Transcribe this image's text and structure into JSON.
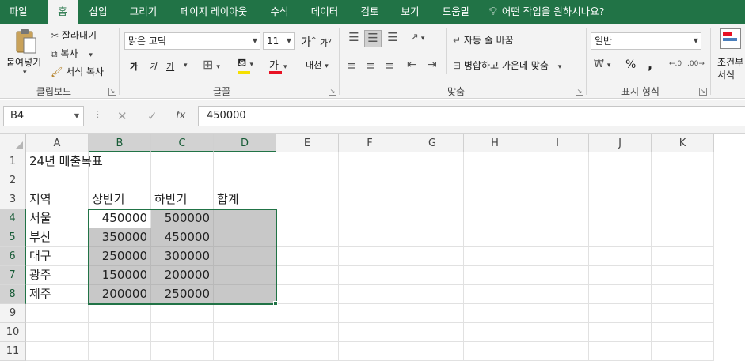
{
  "ribbon_tabs": [
    "파일",
    "홈",
    "삽입",
    "그리기",
    "페이지 레이아웃",
    "수식",
    "데이터",
    "검토",
    "보기",
    "도움말"
  ],
  "tell_me": "어떤 작업을 원하시나요?",
  "clipboard": {
    "paste": "붙여넣기",
    "cut": "잘라내기",
    "copy": "복사",
    "format_painter": "서식 복사",
    "label": "클립보드"
  },
  "font": {
    "family": "맑은 고딕",
    "size": "11",
    "grow": "가",
    "shrink": "가",
    "bold": "가",
    "italic": "가",
    "underline": "가",
    "font_color_glyph": "가",
    "phonetic": "내천",
    "label": "글꼴"
  },
  "alignment": {
    "wrap_text": "자동 줄 바꿈",
    "merge_center": "병합하고 가운데 맞춤",
    "label": "맞춤"
  },
  "number": {
    "format": "일반",
    "percent": "%",
    "comma": ",",
    "label": "표시 형식"
  },
  "styles": {
    "conditional_line1": "조건부",
    "conditional_line2": "서식"
  },
  "formula_bar": {
    "name_box": "B4",
    "cancel": "✕",
    "enter": "✓",
    "fx": "fx",
    "value": "450000"
  },
  "sheet": {
    "columns": [
      "A",
      "B",
      "C",
      "D",
      "E",
      "F",
      "G",
      "H",
      "I",
      "J",
      "K"
    ],
    "rows": [
      "1",
      "2",
      "3",
      "4",
      "5",
      "6",
      "7",
      "8",
      "9",
      "10",
      "11"
    ],
    "cells": {
      "A1": "24년 매출목표",
      "A3": "지역",
      "B3": "상반기",
      "C3": "하반기",
      "D3": "합계",
      "A4": "서울",
      "B4": "450000",
      "C4": "500000",
      "A5": "부산",
      "B5": "350000",
      "C5": "450000",
      "A6": "대구",
      "B6": "250000",
      "C6": "300000",
      "A7": "광주",
      "B7": "150000",
      "C7": "200000",
      "A8": "제주",
      "B8": "200000",
      "C8": "250000"
    }
  },
  "colors": {
    "excel_green": "#217346",
    "selection_fill": "#c8c8c8",
    "header_selected": "#d2d2d2"
  }
}
